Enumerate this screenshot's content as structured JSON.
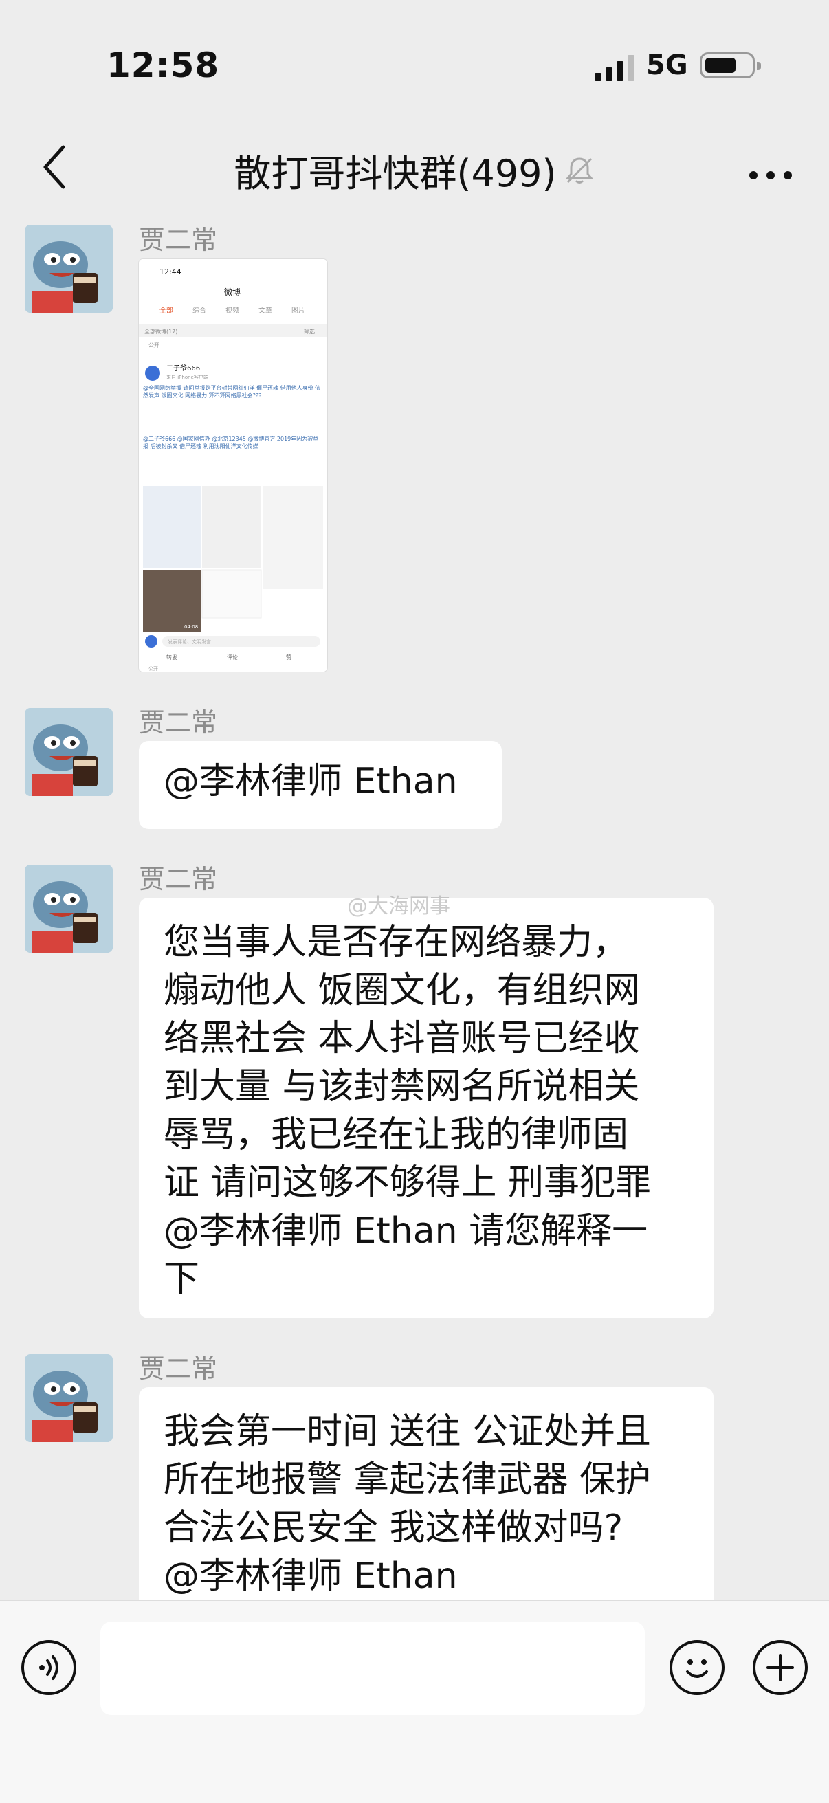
{
  "status": {
    "time": "12:58",
    "network": "5G"
  },
  "nav": {
    "title": "散打哥抖快群(499)"
  },
  "messages": [
    {
      "sender": "贾二常",
      "type": "image"
    },
    {
      "sender": "贾二常",
      "text": "@李林律师 Ethan"
    },
    {
      "sender": "贾二常",
      "text": "您当事人是否存在网络暴力，\n煽动他人 饭圈文化，有组织网\n络黑社会 本人抖音账号已经收\n到大量 与该封禁网名所说相关\n辱骂，我已经在让我的律师固\n证 请问这够不够得上 刑事犯罪\n@李林律师 Ethan 请您解释一\n下"
    },
    {
      "sender": "贾二常",
      "text": "我会第一时间 送往 公证处并且\n所在地报警 拿起法律武器 保护\n合法公民安全 我这样做对吗?\n@李林律师 Ethan"
    }
  ],
  "thumbnail": {
    "time": "12:44",
    "header": "微博",
    "tabs": [
      "全部",
      "综合",
      "视频",
      "文章",
      "图片"
    ],
    "filter_label": "全部微博(17)",
    "filter_action": "筛选",
    "public_label": "公开",
    "user": "二子爷666",
    "user_meta": "来自 iPhone客户端",
    "post_line1": "@全国网络举报 请问举报跨平台封禁网红仙洋 僵尸还魂 借用他人身份 依然发声 饭圈文化 网络暴力 算不算网络黑社会???",
    "post_line2": "@二子爷666 @国家网信办 @北京12345 @微博官方 2019年因为被举报 后被封杀又 借尸还魂 利用沈阳仙洋文化传媒",
    "comment_placeholder": "发表评论、文明发言",
    "actions": [
      "转发",
      "评论",
      "赞"
    ],
    "video_time": "04:08"
  },
  "watermark": "@大海网事",
  "colors": {
    "background": "#ededed",
    "bubble": "#ffffff",
    "sender": "#8c8c8c"
  }
}
